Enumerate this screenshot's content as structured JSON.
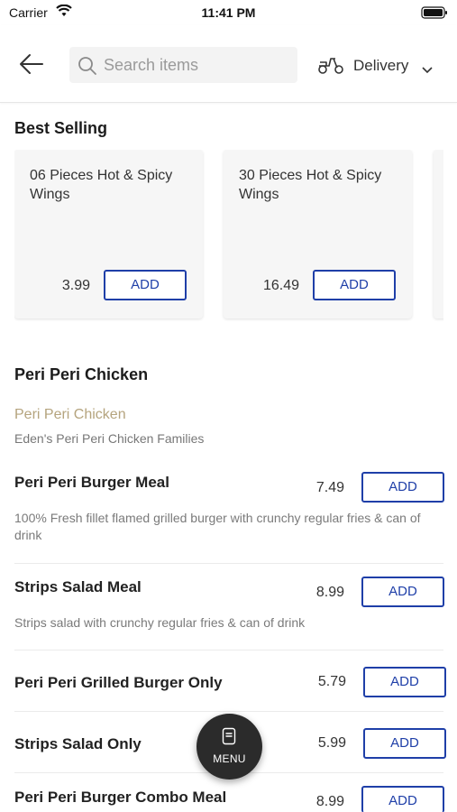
{
  "status_bar": {
    "carrier": "Carrier",
    "time": "11:41 PM"
  },
  "header": {
    "search_placeholder": "Search items",
    "delivery_label": "Delivery"
  },
  "best_selling": {
    "title": "Best Selling",
    "cards": [
      {
        "name": "06 Pieces Hot & Spicy Wings",
        "price": "3.99",
        "button": "ADD"
      },
      {
        "name": "30 Pieces Hot & Spicy Wings",
        "price": "16.49",
        "button": "ADD"
      }
    ]
  },
  "category": {
    "title": "Peri Peri Chicken",
    "subtitle": "Peri Peri Chicken",
    "description": "Eden's Peri Peri Chicken Families",
    "items": [
      {
        "name": "Peri Peri Burger Meal",
        "price": "7.49",
        "button": "ADD",
        "description": "100% Fresh fillet flamed grilled burger with crunchy regular fries & can of drink"
      },
      {
        "name": "Strips Salad Meal",
        "price": "8.99",
        "button": "ADD",
        "description": "Strips salad with crunchy regular fries & can of drink"
      },
      {
        "name": "Peri Peri Grilled Burger Only",
        "price": "5.79",
        "button": "ADD"
      },
      {
        "name": "Strips Salad Only",
        "price": "5.99",
        "button": "ADD"
      },
      {
        "name": "Peri Peri Burger Combo Meal",
        "price": "8.99",
        "button": "ADD"
      }
    ]
  },
  "menu_button": {
    "label": "MENU"
  },
  "colors": {
    "accent": "#1f3fa8",
    "subtitle": "#b5a47e",
    "fab": "#2b2b2b"
  }
}
